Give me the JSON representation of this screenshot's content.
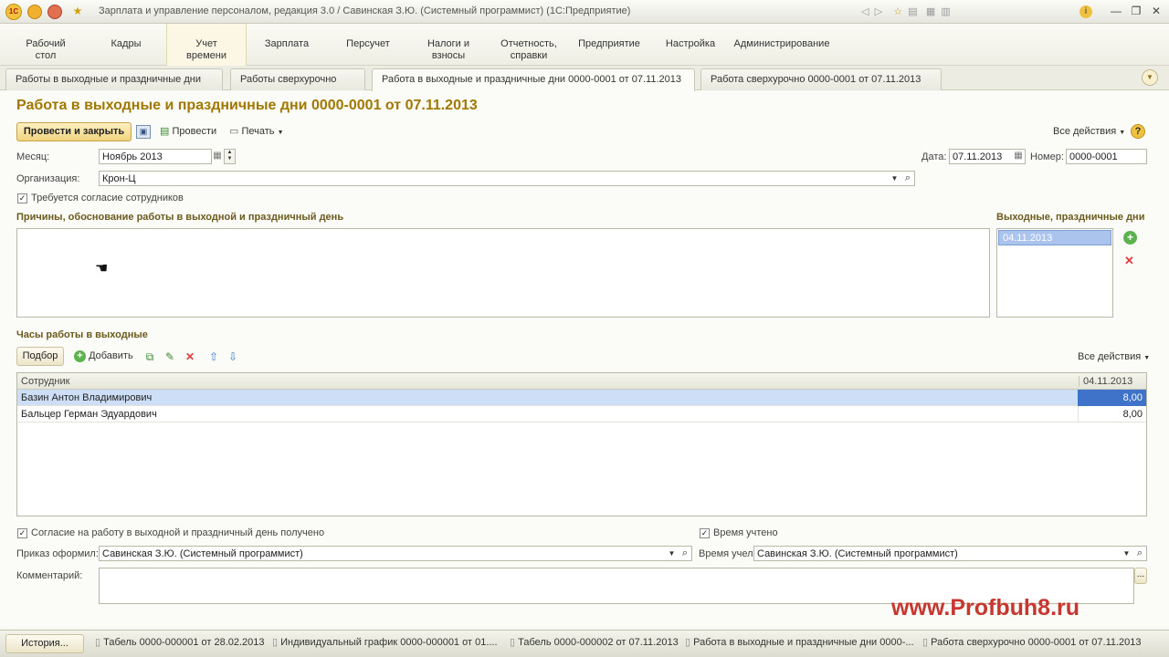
{
  "window": {
    "title": "Зарплата и управление персоналом, редакция 3.0 / Савинская З.Ю. (Системный программист)  (1С:Предприятие)"
  },
  "sections": [
    {
      "label": "Рабочий\nстол"
    },
    {
      "label": "Кадры"
    },
    {
      "label": "Учет\nвремени"
    },
    {
      "label": "Зарплата"
    },
    {
      "label": "Персучет"
    },
    {
      "label": "Налоги и\nвзносы"
    },
    {
      "label": "Отчетность,\nсправки"
    },
    {
      "label": "Предприятие"
    },
    {
      "label": "Настройка"
    },
    {
      "label": "Администрирование"
    }
  ],
  "tabs": [
    {
      "label": "Работы в выходные и праздничные дни"
    },
    {
      "label": "Работы сверхурочно"
    },
    {
      "label": "Работа в выходные и праздничные дни 0000-0001 от 07.11.2013"
    },
    {
      "label": "Работа сверхурочно 0000-0001 от 07.11.2013"
    }
  ],
  "form": {
    "title": "Работа в выходные и праздничные дни 0000-0001 от 07.11.2013",
    "toolbar": {
      "post_close": "Провести и закрыть",
      "post": "Провести",
      "print": "Печать",
      "all_actions": "Все действия",
      "help": "?"
    },
    "month_label": "Месяц:",
    "month_value": "Ноябрь 2013",
    "date_label": "Дата:",
    "date_value": "07.11.2013",
    "number_label": "Номер:",
    "number_value": "0000-0001",
    "org_label": "Организация:",
    "org_value": "Крон-Ц",
    "consent_required_label": "Требуется согласие сотрудников",
    "consent_required_checked": true,
    "reasons_label": "Причины, обоснование работы в выходной и праздничный день",
    "reasons_value": "",
    "holidays_label": "Выходные, праздничные дни",
    "holidays": [
      "04.11.2013"
    ],
    "hours_label": "Часы работы в выходные",
    "grid_toolbar": {
      "select": "Подбор",
      "add": "Добавить",
      "all_actions": "Все действия"
    },
    "grid": {
      "columns": [
        "Сотрудник",
        "04.11.2013"
      ],
      "rows": [
        {
          "employee": "Базин Антон Владимирович",
          "hours": "8,00",
          "selected": true
        },
        {
          "employee": "Бальцер Герман Эдуардович",
          "hours": "8,00",
          "selected": false
        }
      ]
    },
    "consent_received_label": "Согласие на работу в выходной и праздничный день получено",
    "consent_received_checked": true,
    "time_counted_label": "Время учтено",
    "time_counted_checked": true,
    "order_label": "Приказ оформил:",
    "order_value": "Савинская З.Ю. (Системный программист)",
    "time_by_label": "Время учел:",
    "time_by_value": "Савинская З.Ю. (Системный программист)",
    "comment_label": "Комментарий:",
    "comment_value": "",
    "comment_btn": "..."
  },
  "taskbar": {
    "history": "История...",
    "items": [
      "Табель 0000-000001 от 28.02.2013",
      "Индивидуальный график 0000-000001 от 01....",
      "Табель 0000-000002 от 07.11.2013",
      "Работа в выходные и праздничные дни 0000-...",
      "Работа сверхурочно 0000-0001 от 07.11.2013"
    ]
  },
  "watermark": "www.Profbuh8.ru",
  "colors": {
    "accent": "#a07800",
    "selection": "#b8cff0",
    "watermark": "#c7372f"
  }
}
